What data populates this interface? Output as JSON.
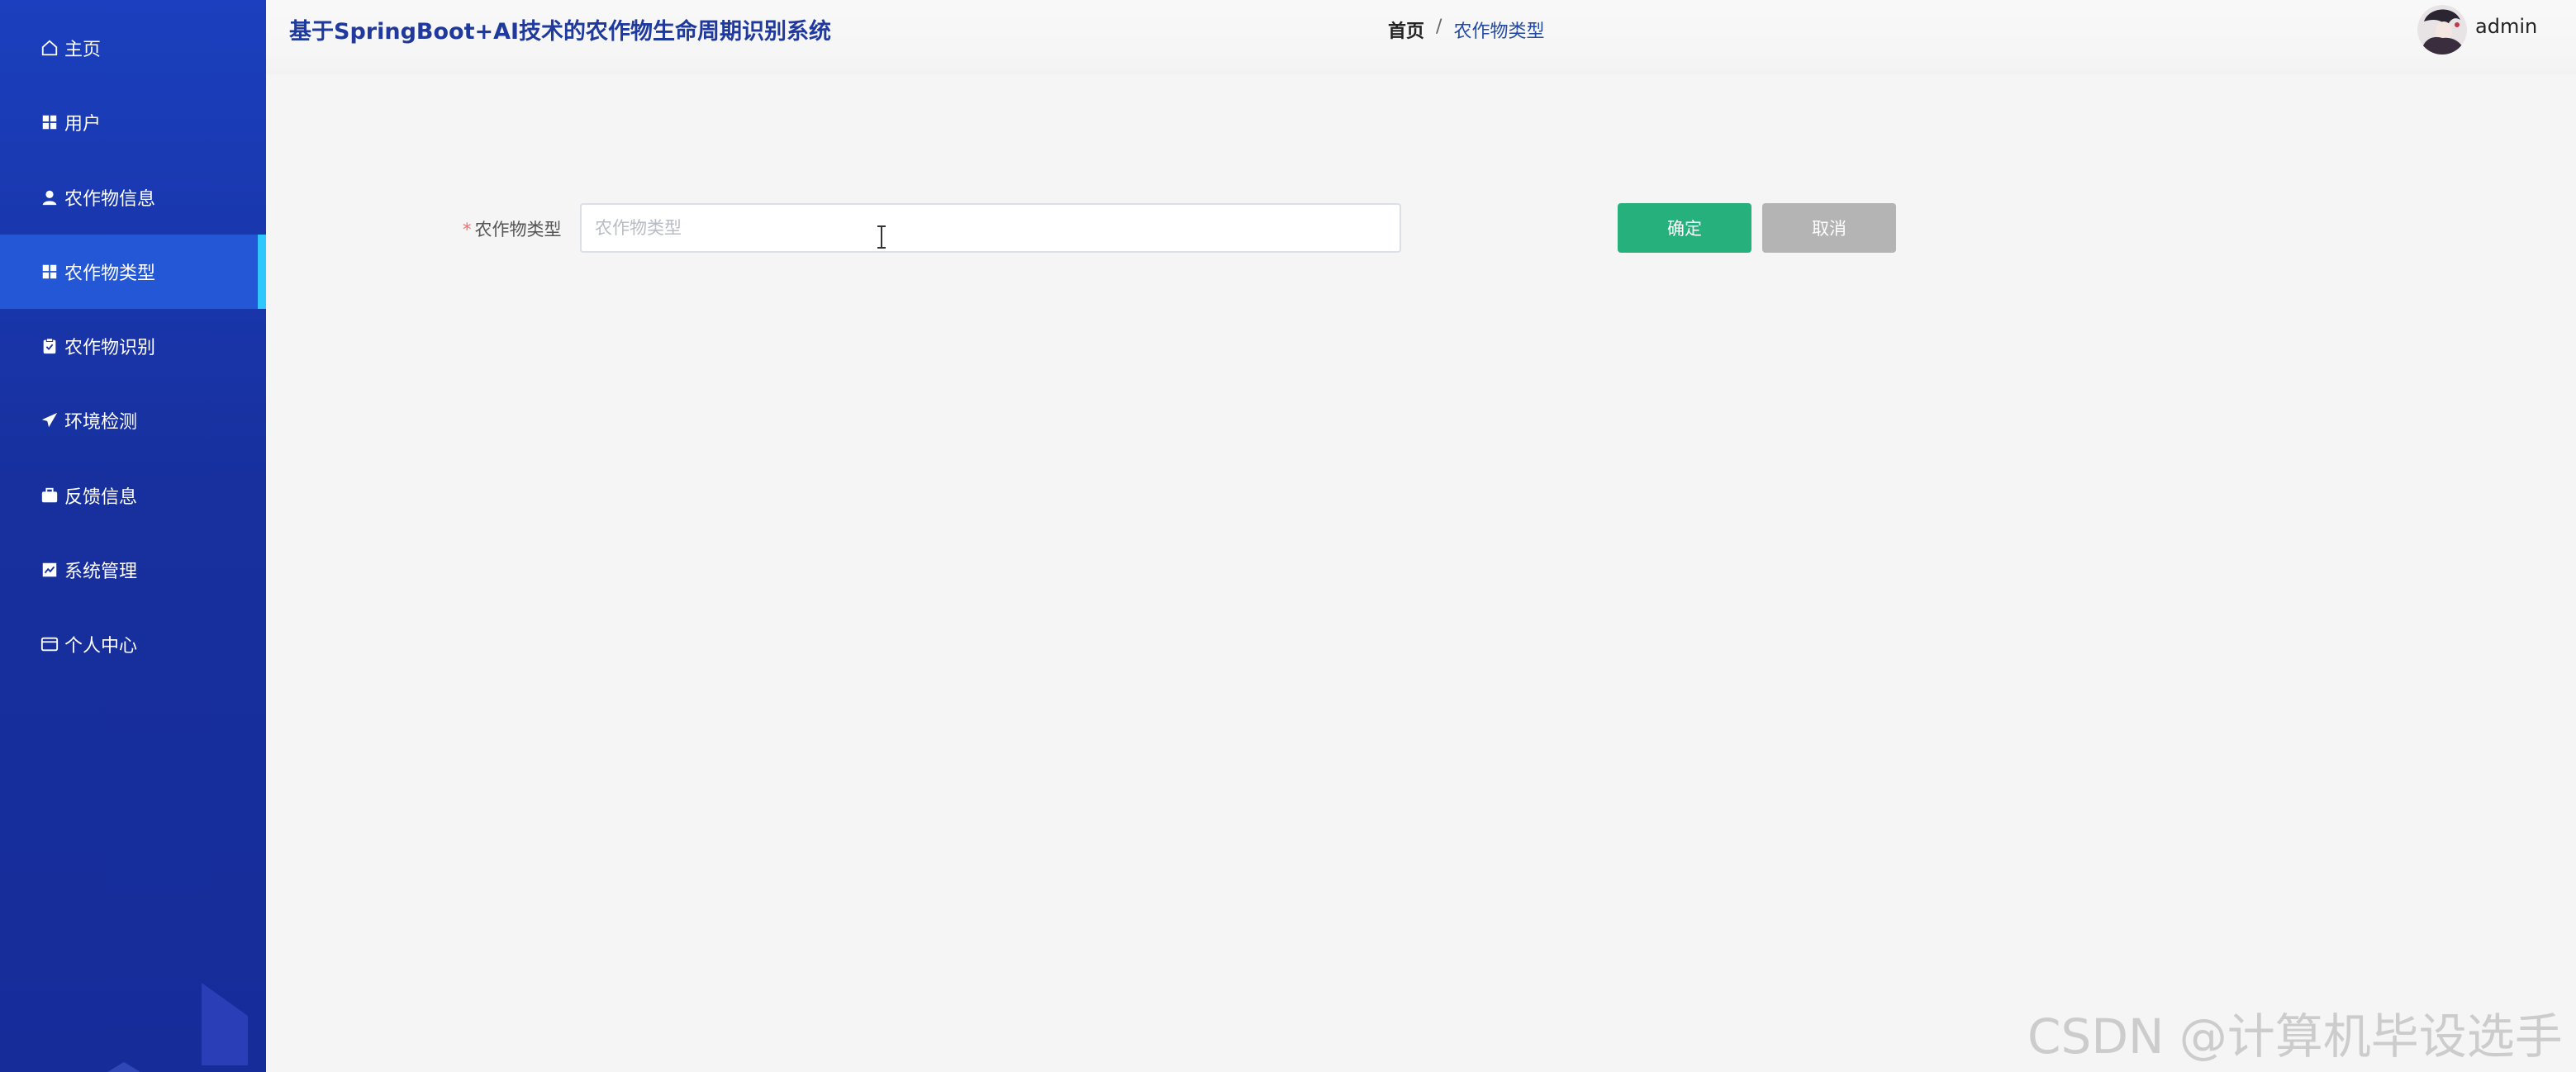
{
  "app": {
    "title": "基于SpringBoot+AI技术的农作物生命周期识别系统"
  },
  "sidebar": {
    "items": [
      {
        "label": "主页",
        "icon": "home-icon"
      },
      {
        "label": "用户",
        "icon": "grid-icon"
      },
      {
        "label": "农作物信息",
        "icon": "user-icon"
      },
      {
        "label": "农作物类型",
        "icon": "grid-icon",
        "active": true
      },
      {
        "label": "农作物识别",
        "icon": "clipboard-icon"
      },
      {
        "label": "环境检测",
        "icon": "send-icon"
      },
      {
        "label": "反馈信息",
        "icon": "briefcase-icon"
      },
      {
        "label": "系统管理",
        "icon": "chart-icon"
      },
      {
        "label": "个人中心",
        "icon": "card-icon"
      }
    ]
  },
  "breadcrumb": {
    "home": "首页",
    "separator": "/",
    "current": "农作物类型"
  },
  "user": {
    "name": "admin"
  },
  "form": {
    "field_label": "农作物类型",
    "required_mark": "*",
    "field_value": "",
    "field_placeholder": "农作物类型"
  },
  "buttons": {
    "ok": "确定",
    "cancel": "取消"
  },
  "watermark": "CSDN @计算机毕设选手",
  "colors": {
    "sidebar_bg": "#17309e",
    "active_item_bg": "#2357d6",
    "active_indicator": "#2ec8ff",
    "title_color": "#1f3a9c",
    "ok_button": "#26b07c",
    "cancel_button": "#b4b4b4"
  }
}
